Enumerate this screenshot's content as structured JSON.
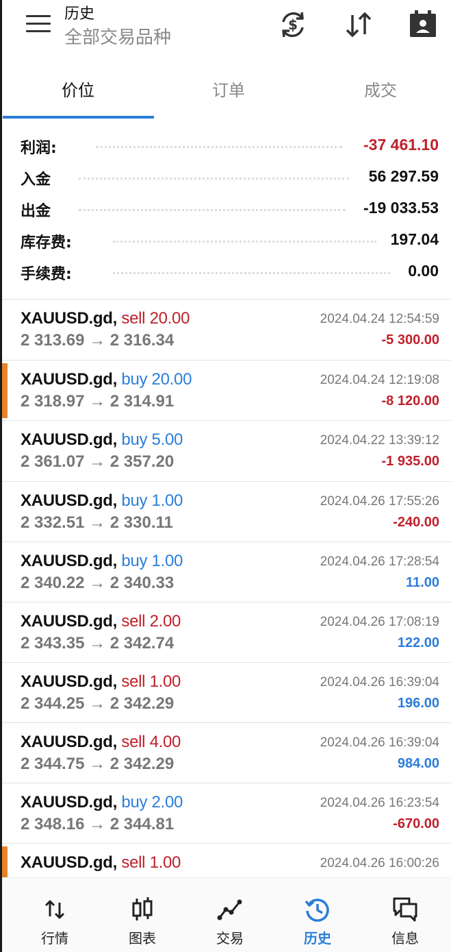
{
  "header": {
    "title": "历史",
    "subtitle": "全部交易品种"
  },
  "tabs": [
    {
      "label": "价位",
      "active": true
    },
    {
      "label": "订单",
      "active": false
    },
    {
      "label": "成交",
      "active": false
    }
  ],
  "summary": [
    {
      "label": "利润:",
      "value": "-37 461.10",
      "negative": true
    },
    {
      "label": "入金",
      "value": "56 297.59",
      "negative": false
    },
    {
      "label": "出金",
      "value": "-19 033.53",
      "negative": false
    },
    {
      "label": "库存费:",
      "value": "197.04",
      "negative": false
    },
    {
      "label": "手续费:",
      "value": "0.00",
      "negative": false
    }
  ],
  "deals": [
    {
      "symbol": "XAUUSD.gd,",
      "side": "sell",
      "volume": "sell 20.00",
      "prices": "2 313.69 → 2 316.34",
      "time": "2024.04.24 12:54:59",
      "profit": "-5 300.00",
      "marked": false
    },
    {
      "symbol": "XAUUSD.gd,",
      "side": "buy",
      "volume": "buy 20.00",
      "prices": "2 318.97 → 2 314.91",
      "time": "2024.04.24 12:19:08",
      "profit": "-8 120.00",
      "marked": true
    },
    {
      "symbol": "XAUUSD.gd,",
      "side": "buy",
      "volume": "buy 5.00",
      "prices": "2 361.07 → 2 357.20",
      "time": "2024.04.22 13:39:12",
      "profit": "-1 935.00",
      "marked": false
    },
    {
      "symbol": "XAUUSD.gd,",
      "side": "buy",
      "volume": "buy 1.00",
      "prices": "2 332.51 → 2 330.11",
      "time": "2024.04.26 17:55:26",
      "profit": "-240.00",
      "marked": false
    },
    {
      "symbol": "XAUUSD.gd,",
      "side": "buy",
      "volume": "buy 1.00",
      "prices": "2 340.22 → 2 340.33",
      "time": "2024.04.26 17:28:54",
      "profit": "11.00",
      "marked": false
    },
    {
      "symbol": "XAUUSD.gd,",
      "side": "sell",
      "volume": "sell 2.00",
      "prices": "2 343.35 → 2 342.74",
      "time": "2024.04.26 17:08:19",
      "profit": "122.00",
      "marked": false
    },
    {
      "symbol": "XAUUSD.gd,",
      "side": "sell",
      "volume": "sell 1.00",
      "prices": "2 344.25 → 2 342.29",
      "time": "2024.04.26 16:39:04",
      "profit": "196.00",
      "marked": false
    },
    {
      "symbol": "XAUUSD.gd,",
      "side": "sell",
      "volume": "sell 4.00",
      "prices": "2 344.75 → 2 342.29",
      "time": "2024.04.26 16:39:04",
      "profit": "984.00",
      "marked": false
    },
    {
      "symbol": "XAUUSD.gd,",
      "side": "buy",
      "volume": "buy 2.00",
      "prices": "2 348.16 → 2 344.81",
      "time": "2024.04.26 16:23:54",
      "profit": "-670.00",
      "marked": false
    },
    {
      "symbol": "XAUUSD.gd,",
      "side": "sell",
      "volume": "sell 1.00",
      "prices": "",
      "time": "2024.04.26 16:00:26",
      "profit": "",
      "marked": true
    }
  ],
  "bottom_nav": [
    {
      "label": "行情",
      "icon": "quotes-icon",
      "active": false
    },
    {
      "label": "图表",
      "icon": "chart-icon",
      "active": false
    },
    {
      "label": "交易",
      "icon": "trade-icon",
      "active": false
    },
    {
      "label": "历史",
      "icon": "history-icon",
      "active": true
    },
    {
      "label": "信息",
      "icon": "messages-icon",
      "active": false
    }
  ],
  "colors": {
    "accent": "#2b7dd9",
    "loss": "#c0202a",
    "marker": "#e8822a"
  }
}
